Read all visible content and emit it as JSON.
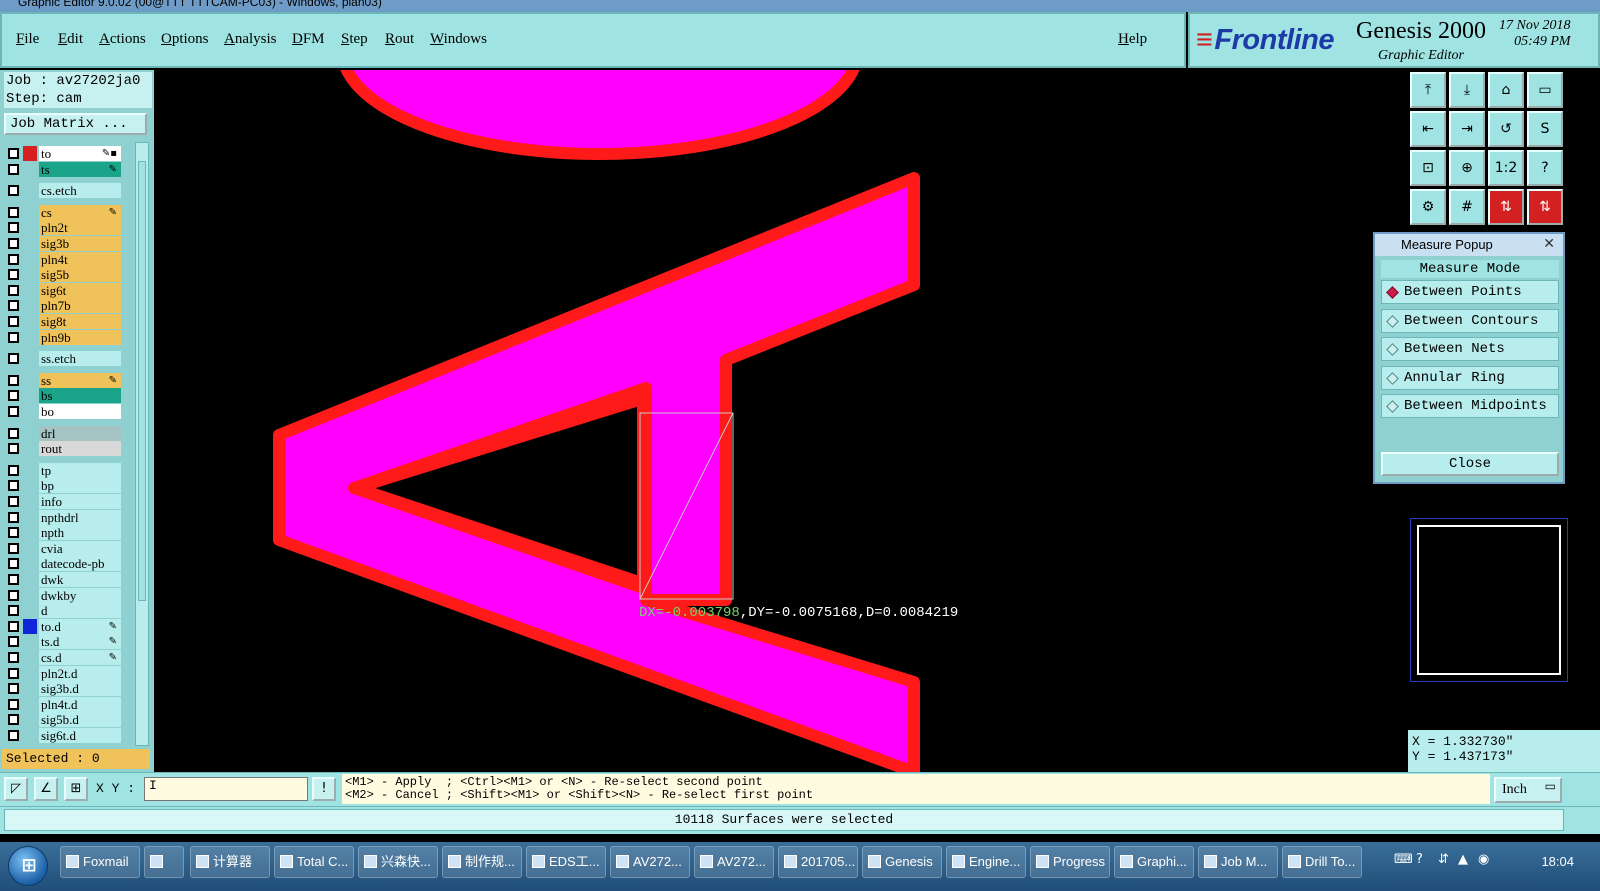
{
  "window": {
    "title": "Graphic Editor 9.0.02 (00@TTT TTTCAM-PC03) - Windows, plan03)"
  },
  "menu": {
    "items": [
      "File",
      "Edit",
      "Actions",
      "Options",
      "Analysis",
      "DFM",
      "Step",
      "Rout",
      "Windows"
    ],
    "help": "Help"
  },
  "brand": {
    "logo": "Frontline",
    "product": "Genesis 2000",
    "subtitle": "Graphic Editor",
    "date": "17 Nov 2018",
    "time": "05:49 PM"
  },
  "job": {
    "job_line": "Job : av27202ja0",
    "step_line": "Step: cam",
    "matrix_button": "Job Matrix ..."
  },
  "layers": [
    {
      "name": "to",
      "color": "#ffffff",
      "swatch": "#d61f1f",
      "mark": "✎▪"
    },
    {
      "name": "ts",
      "color": "#1aa58a",
      "swatch": "",
      "mark": "✎"
    },
    {
      "name": "cs.etch",
      "color": "#b8eded",
      "swatch": "",
      "mark": ""
    },
    {
      "name": "cs",
      "color": "#f0c25a",
      "swatch": "",
      "mark": "✎"
    },
    {
      "name": "pln2t",
      "color": "#f0c25a",
      "swatch": "",
      "mark": ""
    },
    {
      "name": "sig3b",
      "color": "#f0c25a",
      "swatch": "",
      "mark": ""
    },
    {
      "name": "pln4t",
      "color": "#f0c25a",
      "swatch": "",
      "mark": ""
    },
    {
      "name": "sig5b",
      "color": "#f0c25a",
      "swatch": "",
      "mark": ""
    },
    {
      "name": "sig6t",
      "color": "#f0c25a",
      "swatch": "",
      "mark": ""
    },
    {
      "name": "pln7b",
      "color": "#f0c25a",
      "swatch": "",
      "mark": ""
    },
    {
      "name": "sig8t",
      "color": "#f0c25a",
      "swatch": "",
      "mark": ""
    },
    {
      "name": "pln9b",
      "color": "#f0c25a",
      "swatch": "",
      "mark": ""
    },
    {
      "name": "ss.etch",
      "color": "#b8eded",
      "swatch": "",
      "mark": ""
    },
    {
      "name": "ss",
      "color": "#f0c25a",
      "swatch": "",
      "mark": "✎"
    },
    {
      "name": "bs",
      "color": "#1aa58a",
      "swatch": "",
      "mark": ""
    },
    {
      "name": "bo",
      "color": "#ffffff",
      "swatch": "",
      "mark": ""
    },
    {
      "name": "drl",
      "color": "#a6c3c3",
      "swatch": "",
      "mark": ""
    },
    {
      "name": "rout",
      "color": "#d9d9d9",
      "swatch": "",
      "mark": ""
    },
    {
      "name": "tp",
      "color": "#b8eded",
      "swatch": "",
      "mark": ""
    },
    {
      "name": "bp",
      "color": "#b8eded",
      "swatch": "",
      "mark": ""
    },
    {
      "name": "info",
      "color": "#b8eded",
      "swatch": "",
      "mark": ""
    },
    {
      "name": "npthdrl",
      "color": "#b8eded",
      "swatch": "",
      "mark": ""
    },
    {
      "name": "npth",
      "color": "#b8eded",
      "swatch": "",
      "mark": ""
    },
    {
      "name": "cvia",
      "color": "#b8eded",
      "swatch": "",
      "mark": ""
    },
    {
      "name": "datecode-pb",
      "color": "#b8eded",
      "swatch": "",
      "mark": ""
    },
    {
      "name": "dwk",
      "color": "#b8eded",
      "swatch": "",
      "mark": ""
    },
    {
      "name": "dwkby",
      "color": "#b8eded",
      "swatch": "",
      "mark": ""
    },
    {
      "name": "d",
      "color": "#b8eded",
      "swatch": "",
      "mark": ""
    },
    {
      "name": "to.d",
      "color": "#b8eded",
      "swatch": "#1024d8",
      "mark": "✎"
    },
    {
      "name": "ts.d",
      "color": "#b8eded",
      "swatch": "",
      "mark": "✎"
    },
    {
      "name": "cs.d",
      "color": "#b8eded",
      "swatch": "",
      "mark": "✎"
    },
    {
      "name": "pln2t.d",
      "color": "#b8eded",
      "swatch": "",
      "mark": ""
    },
    {
      "name": "sig3b.d",
      "color": "#b8eded",
      "swatch": "",
      "mark": ""
    },
    {
      "name": "pln4t.d",
      "color": "#b8eded",
      "swatch": "",
      "mark": ""
    },
    {
      "name": "sig5b.d",
      "color": "#b8eded",
      "swatch": "",
      "mark": ""
    },
    {
      "name": "sig6t.d",
      "color": "#b8eded",
      "swatch": "",
      "mark": ""
    }
  ],
  "selected": "Selected : 0",
  "canvas": {
    "measure_dx": "DX=-0.003798",
    "measure_rest": ",DY=-0.0075168,D=0.0084219",
    "fill_color": "#ff00ff",
    "outline_color": "#ff1a1a"
  },
  "toolbar_right": {
    "buttons": [
      {
        "icon": "zoom-home-icon",
        "glyph": "⤒"
      },
      {
        "icon": "pan-down-icon",
        "glyph": "⤓"
      },
      {
        "icon": "home-icon",
        "glyph": "⌂"
      },
      {
        "icon": "window-icon",
        "glyph": "▭"
      },
      {
        "icon": "pan-left-icon",
        "glyph": "⇤"
      },
      {
        "icon": "pan-right-icon",
        "glyph": "⇥"
      },
      {
        "icon": "undo-zoom-icon",
        "glyph": "↺"
      },
      {
        "icon": "redraw-icon",
        "glyph": "S"
      },
      {
        "icon": "fit-all-icon",
        "glyph": "⊡"
      },
      {
        "icon": "center-icon",
        "glyph": "⊕"
      },
      {
        "icon": "scale-icon",
        "glyph": "1:2"
      },
      {
        "icon": "help-icon",
        "glyph": "?"
      },
      {
        "icon": "settings-icon",
        "glyph": "⚙"
      },
      {
        "icon": "grid-icon",
        "glyph": "#"
      },
      {
        "icon": "layer-up-icon",
        "glyph": "⇅",
        "alert": true
      },
      {
        "icon": "layer-down-icon",
        "glyph": "⇅",
        "alert": true
      }
    ]
  },
  "coords": {
    "x": "X = 1.332730\"",
    "y": "Y = 1.437173\""
  },
  "measure_popup": {
    "title": "Measure Popup",
    "mode_title": "Measure Mode",
    "options": [
      {
        "label": "Between Points",
        "active": true
      },
      {
        "label": "Between Contours",
        "active": false
      },
      {
        "label": "Between Nets",
        "active": false
      },
      {
        "label": "Annular Ring",
        "active": false
      },
      {
        "label": "Between Midpoints",
        "active": false
      }
    ],
    "close": "Close"
  },
  "command_bar": {
    "xy_label": "X Y :",
    "xy_value": "I",
    "hint_line1": "<M1> - Apply  ; <Ctrl><M1> or <N> - Re-select second point",
    "hint_line2": "<M2> - Cancel ; <Shift><M1> or <Shift><N> - Re-select first point",
    "units": "Inch"
  },
  "status": "10118 Surfaces were selected",
  "taskbar": {
    "start": "⊞",
    "tasks": [
      "Foxmail",
      "",
      "计算器",
      "Total C...",
      "兴森快...",
      "制作规...",
      "EDS工...",
      "AV272...",
      "AV272...",
      "201705...",
      "Genesis",
      "Engine...",
      "Progress",
      "Graphi...",
      "Job M...",
      "Drill To..."
    ],
    "clock": "18:04"
  }
}
